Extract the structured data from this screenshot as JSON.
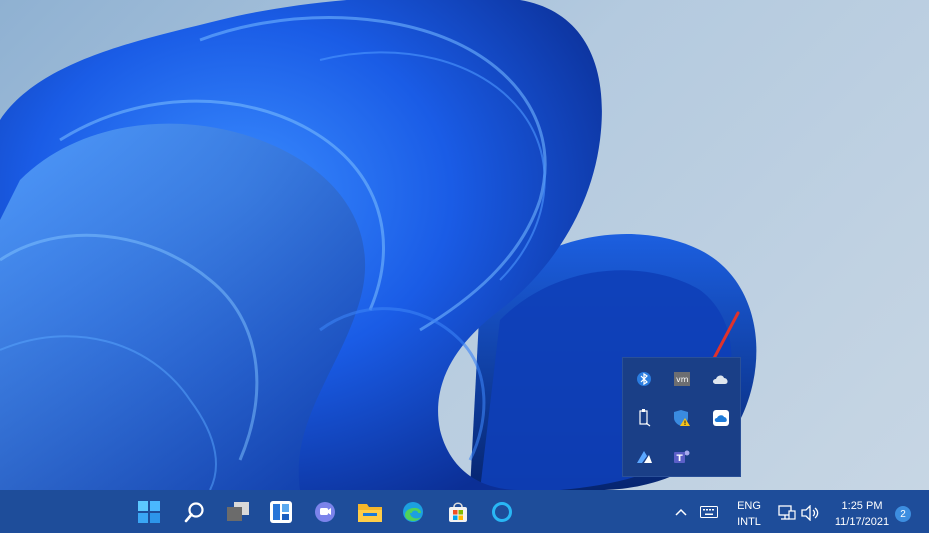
{
  "taskbar": {
    "apps": [
      {
        "name": "start-icon"
      },
      {
        "name": "search-icon"
      },
      {
        "name": "task-view-icon"
      },
      {
        "name": "widgets-icon"
      },
      {
        "name": "teams-chat-icon"
      },
      {
        "name": "file-explorer-icon"
      },
      {
        "name": "edge-icon"
      },
      {
        "name": "store-icon"
      },
      {
        "name": "cortana-icon"
      }
    ],
    "language_line1": "ENG",
    "language_line2": "INTL",
    "time": "1:25 PM",
    "date": "11/17/2021",
    "notification_count": "2"
  },
  "tray_overflow": {
    "icons": [
      "bluetooth-icon",
      "vmware-icon",
      "onedrive-icon",
      "usb-eject-icon",
      "windows-security-warning-icon",
      "onedrive-personal-icon",
      "azure-icon",
      "teams-icon"
    ]
  },
  "colors": {
    "taskbar_bg": "#1e4d9a",
    "tray_bg": "#1a3f87",
    "accent": "#3d8ee0",
    "annotation_arrow": "#e0322b"
  }
}
